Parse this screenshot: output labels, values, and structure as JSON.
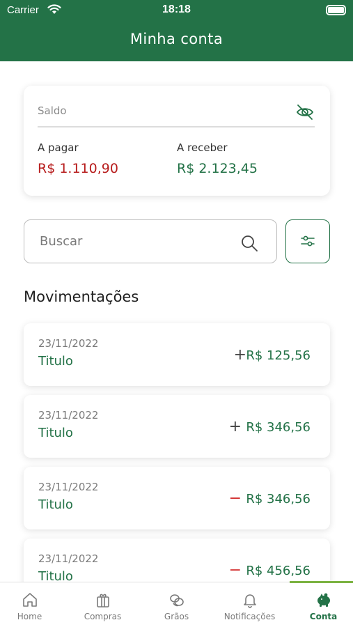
{
  "status_bar": {
    "carrier": "Carrier",
    "time": "18:18"
  },
  "header": {
    "title": "Minha conta"
  },
  "balance": {
    "label": "Saldo",
    "payable_label": "A pagar",
    "payable_value": "R$ 1.110,90",
    "receivable_label": "A receber",
    "receivable_value": "R$ 2.123,45"
  },
  "search": {
    "placeholder": "Buscar",
    "value": ""
  },
  "section_title": "Movimentações",
  "transactions": [
    {
      "date": "23/11/2022",
      "title": "Titulo",
      "sign": "+",
      "amount": "R$ 125,56"
    },
    {
      "date": "23/11/2022",
      "title": "Titulo",
      "sign": "+",
      "amount": "R$ 346,56"
    },
    {
      "date": "23/11/2022",
      "title": "Titulo",
      "sign": "−",
      "amount": "R$ 346,56"
    },
    {
      "date": "23/11/2022",
      "title": "Titulo",
      "sign": "−",
      "amount": "R$ 456,56"
    }
  ],
  "tabs": [
    {
      "label": "Home",
      "icon": "home-icon"
    },
    {
      "label": "Compras",
      "icon": "gift-icon"
    },
    {
      "label": "Grãos",
      "icon": "grains-icon"
    },
    {
      "label": "Notificações",
      "icon": "bell-icon"
    },
    {
      "label": "Conta",
      "icon": "piggy-bank-icon",
      "active": true
    }
  ],
  "colors": {
    "brand": "#237247",
    "negative": "#b71c1c",
    "accent": "#7cb342"
  }
}
